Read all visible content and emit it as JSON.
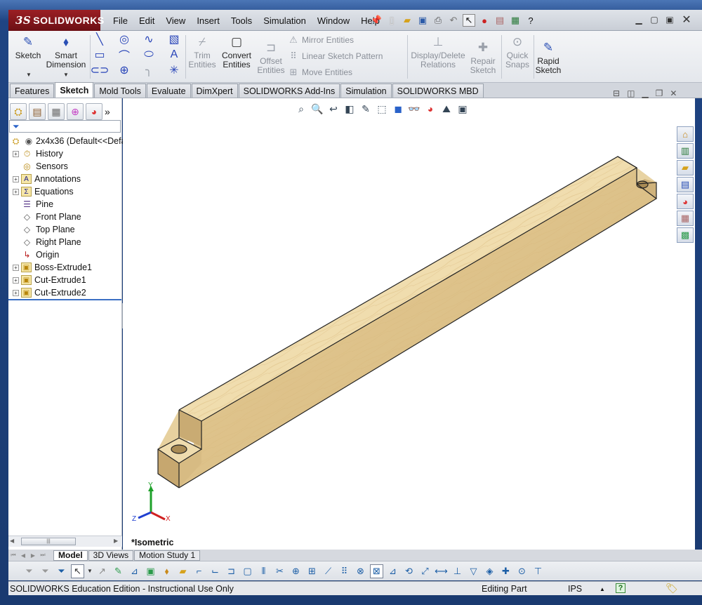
{
  "app": {
    "brand": "SOLIDWORKS",
    "brand_prefix": "3S"
  },
  "menu": [
    "File",
    "Edit",
    "View",
    "Insert",
    "Tools",
    "Simulation",
    "Window",
    "Help"
  ],
  "ribbon": {
    "sketch": "Sketch",
    "smart_dimension": "Smart Dimension",
    "trim_entities": "Trim Entities",
    "convert_entities": "Convert Entities",
    "offset_entities": "Offset Entities",
    "mirror_entities": "Mirror Entities",
    "linear_sketch_pattern": "Linear Sketch Pattern",
    "move_entities": "Move Entities",
    "display_delete_relations": "Display/Delete Relations",
    "repair_sketch": "Repair Sketch",
    "quick_snaps": "Quick Snaps",
    "rapid_sketch": "Rapid Sketch"
  },
  "tabs": [
    "Features",
    "Sketch",
    "Mold Tools",
    "Evaluate",
    "DimXpert",
    "SOLIDWORKS Add-Ins",
    "Simulation",
    "SOLIDWORKS MBD"
  ],
  "active_tab": "Sketch",
  "feature_tree": {
    "root": "2x4x36  (Default<<Defa",
    "items": [
      {
        "label": "History",
        "expandable": true
      },
      {
        "label": "Sensors",
        "expandable": false
      },
      {
        "label": "Annotations",
        "expandable": true
      },
      {
        "label": "Equations",
        "expandable": true
      },
      {
        "label": "Pine",
        "expandable": false
      },
      {
        "label": "Front Plane",
        "expandable": false
      },
      {
        "label": "Top Plane",
        "expandable": false
      },
      {
        "label": "Right Plane",
        "expandable": false
      },
      {
        "label": "Origin",
        "expandable": false
      },
      {
        "label": "Boss-Extrude1",
        "expandable": true
      },
      {
        "label": "Cut-Extrude1",
        "expandable": true
      },
      {
        "label": "Cut-Extrude2",
        "expandable": true
      }
    ]
  },
  "viewport": {
    "view_name": "*Isometric"
  },
  "triad": {
    "x": "X",
    "y": "Y",
    "z": "Z"
  },
  "bottom_tabs": [
    "Model",
    "3D Views",
    "Motion Study 1"
  ],
  "active_bottom_tab": "Model",
  "status": {
    "edition": "SOLIDWORKS Education Edition - Instructional Use Only",
    "mode": "Editing Part",
    "units": "IPS",
    "up_arrow": "▲",
    "help": "?"
  },
  "colors": {
    "wood_top": "#f1deb0",
    "wood_side": "#dcc08a",
    "wood_end": "#cbb07c",
    "brand_red": "#8e1a1f"
  }
}
